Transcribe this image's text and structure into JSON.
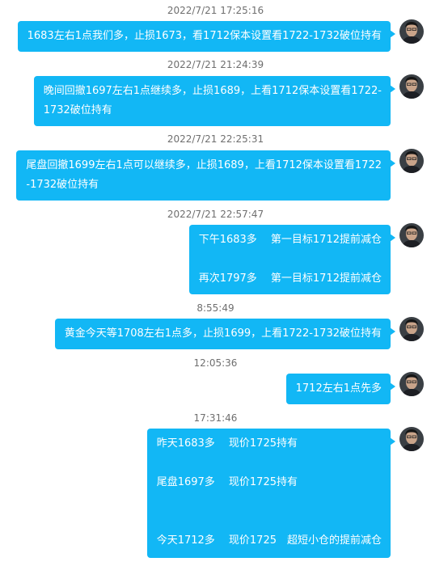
{
  "messages": [
    {
      "time": "2022/7/21 17:25:16",
      "lines": [
        "1683左右1点我们多，止损1673，看1712保本设置看1722-1732破位持有"
      ]
    },
    {
      "time": "2022/7/21 21:24:39",
      "lines": [
        "晚间回撤1697左右1点继续多，止损1689，上看1712保本设置看1722-",
        "1732破位持有"
      ]
    },
    {
      "time": "2022/7/21 22:25:31",
      "lines": [
        "尾盘回撤1699左右1点可以继续多，止损1689，上看1712保本设置看1722",
        "-1732破位持有"
      ]
    },
    {
      "time": "2022/7/21 22:57:47",
      "lines": [
        "下午1683多　 第一目标1712提前减仓",
        "再次1797多　 第一目标1712提前减仓"
      ]
    },
    {
      "time": "8:55:49",
      "lines": [
        "黄金今天等1708左右1点多，止损1699，上看1722-1732破位持有"
      ]
    },
    {
      "time": "12:05:36",
      "lines": [
        "1712左右1点先多"
      ]
    },
    {
      "time": "17:31:46",
      "lines": [
        "昨天1683多　 现价1725持有",
        "尾盘1697多　 现价1725持有",
        "今天1712多　 现价1725　超短小仓的提前减仓"
      ]
    }
  ],
  "avatar_icon": "user-avatar-icon",
  "colors": {
    "bubble": "#12b7f5",
    "bubble_text": "#ffffff",
    "timestamp": "#6f6f6f"
  }
}
